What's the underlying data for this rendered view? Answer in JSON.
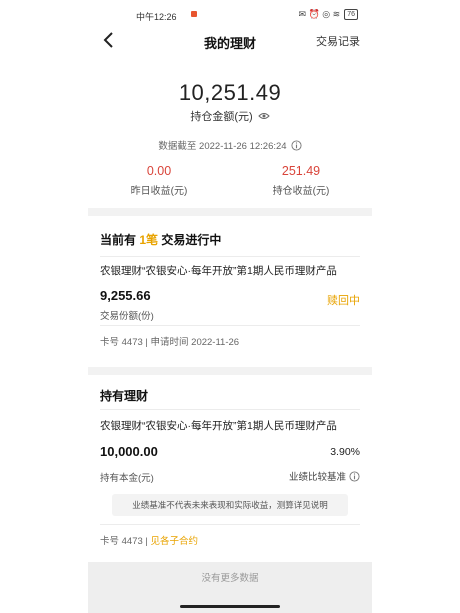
{
  "status_bar": {
    "time": "中午12:26",
    "icons": "✉ ⏰ ◎ ≋",
    "battery": "76"
  },
  "nav": {
    "title": "我的理财",
    "right_link": "交易记录"
  },
  "summary": {
    "total_amount": "10,251.49",
    "total_label": "持仓金额(元)",
    "data_time": "数据截至 2022-11-26 12:26:24",
    "yesterday_value": "0.00",
    "yesterday_label": "昨日收益(元)",
    "holding_value": "251.49",
    "holding_label": "持仓收益(元)"
  },
  "pending": {
    "title_prefix": "当前有",
    "title_count": "1笔",
    "title_suffix": "交易进行中",
    "product_name": "农银理财“农银安心·每年开放”第1期人民币理财产品",
    "amount": "9,255.66",
    "amount_label": "交易份额(份)",
    "status": "赎回中",
    "meta": "卡号 4473 | 申请时间 2022-11-26"
  },
  "holding": {
    "title": "持有理财",
    "product_name": "农银理财“农银安心·每年开放”第1期人民币理财产品",
    "amount": "10,000.00",
    "amount_label": "持有本金(元)",
    "rate": "3.90%",
    "rate_label": "业绩比较基准",
    "note": "业绩基准不代表未来表现和实际收益，测算详见说明",
    "card_text": "卡号 4473 | ",
    "contract_link": "见各子合约"
  },
  "footer": {
    "text": "没有更多数据"
  },
  "colors": {
    "accent": "#e8a300",
    "red": "#d9443a",
    "band": "#f2f2f2"
  }
}
